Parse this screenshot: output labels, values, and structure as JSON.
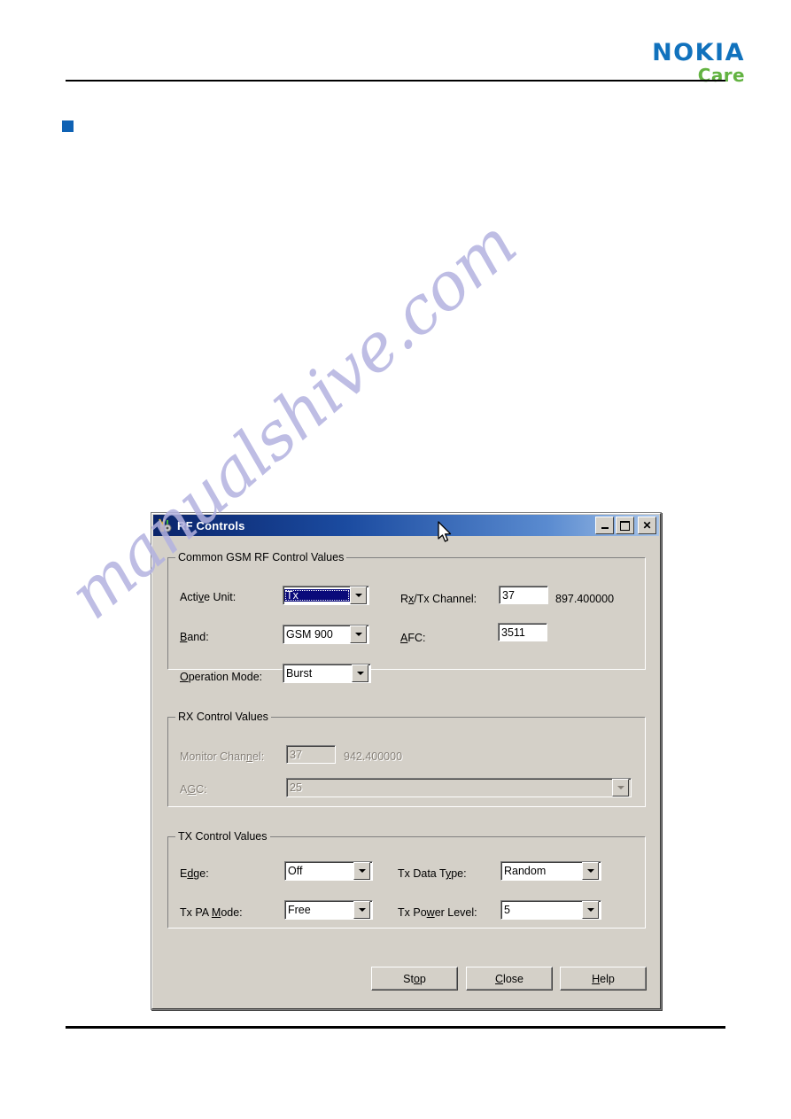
{
  "page": {
    "logo_primary": "NOKIA",
    "logo_secondary": "Care",
    "watermark": "manualshive.com",
    "colors": {
      "nokia_blue": "#1172bd",
      "care_green": "#63b342",
      "bullet_blue": "#0f62b4",
      "titlebar_blue": "#0a246a",
      "dialog_face": "#d4d0c8",
      "selection_blue": "#0a0a7a",
      "watermark": "#b3b2e0"
    }
  },
  "dialog": {
    "title": "RF Controls",
    "icon": "rf-tools-icon",
    "window_buttons": {
      "minimize": "minimize-icon",
      "maximize": "maximize-icon",
      "close": "✕"
    },
    "groups": {
      "common": {
        "title": "Common GSM RF Control Values",
        "fields": {
          "active_unit": {
            "label_pre": "Acti",
            "label_mn": "v",
            "label_post": "e Unit:",
            "value": "Tx",
            "focused": true
          },
          "band": {
            "label_pre": "",
            "label_mn": "B",
            "label_post": "and:",
            "value": "GSM 900"
          },
          "operation_mode": {
            "label_pre": "",
            "label_mn": "O",
            "label_post": "peration Mode:",
            "value": "Burst"
          },
          "rx_tx_channel": {
            "label_pre": "R",
            "label_mn": "x",
            "label_post": "/Tx Channel:",
            "value": "37",
            "frequency": "897.400000"
          },
          "afc": {
            "label_pre": "",
            "label_mn": "A",
            "label_post": "FC:",
            "value": "3511"
          }
        }
      },
      "rx": {
        "title": "RX Control Values",
        "disabled": true,
        "fields": {
          "monitor_channel": {
            "label_pre": "Monitor Chan",
            "label_mn": "n",
            "label_post": "el:",
            "value": "37",
            "frequency": "942.400000"
          },
          "agc": {
            "label_pre": "A",
            "label_mn": "G",
            "label_post": "C:",
            "value": "25"
          }
        }
      },
      "tx": {
        "title": "TX Control Values",
        "fields": {
          "edge": {
            "label_pre": "E",
            "label_mn": "d",
            "label_post": "ge:",
            "value": "Off"
          },
          "tx_pa_mode": {
            "label_pre": "Tx PA ",
            "label_mn": "M",
            "label_post": "ode:",
            "value": "Free"
          },
          "tx_data_type": {
            "label_pre": "Tx Data T",
            "label_mn": "y",
            "label_post": "pe:",
            "value": "Random"
          },
          "tx_power_level": {
            "label_pre": "Tx Po",
            "label_mn": "w",
            "label_post": "er Level:",
            "value": "5"
          }
        }
      }
    },
    "buttons": {
      "stop": {
        "pre": "St",
        "mn": "o",
        "post": "p"
      },
      "close": {
        "pre": "",
        "mn": "C",
        "post": "lose"
      },
      "help": {
        "pre": "",
        "mn": "H",
        "post": "elp"
      }
    }
  }
}
